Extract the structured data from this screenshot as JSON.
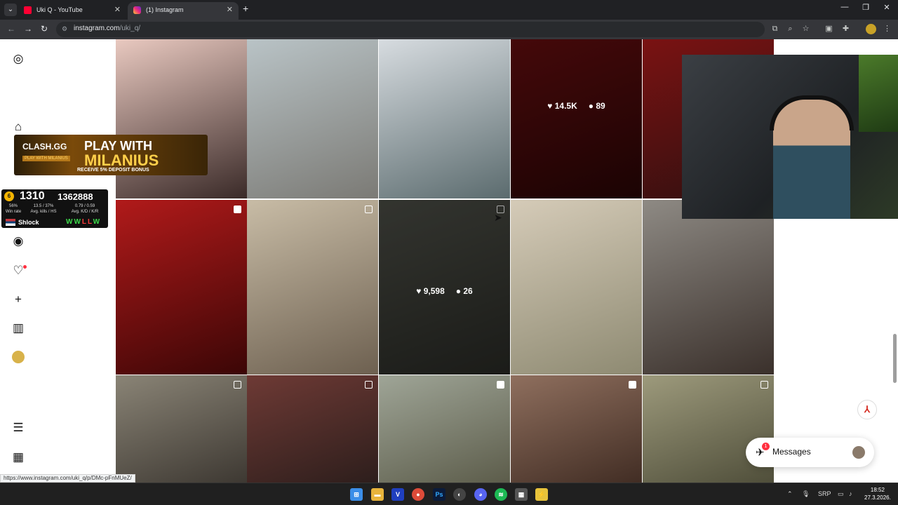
{
  "browser": {
    "tabs": [
      {
        "title": "Uki Q - YouTube"
      },
      {
        "title": "(1) Instagram"
      }
    ],
    "new_tab": "+",
    "url_host": "instagram.com",
    "url_path": "/uki_q/",
    "status_url": "https://www.instagram.com/uki_q/p/DMc-pFnMUeZ/"
  },
  "instagram": {
    "posts": [
      {
        "kind": "image",
        "colors": [
          "#e9c9c0",
          "#3a2a28"
        ]
      },
      {
        "kind": "image",
        "colors": [
          "#b9c3c6",
          "#7b7a75"
        ]
      },
      {
        "kind": "image",
        "colors": [
          "#d7dce0",
          "#5b6b6e"
        ]
      },
      {
        "kind": "image",
        "colors": [
          "#6a0e10",
          "#2a0606"
        ],
        "likes": "14.5K",
        "comments": "89"
      },
      {
        "kind": "image",
        "colors": [
          "#7a1212",
          "#301010"
        ]
      },
      {
        "kind": "reel",
        "colors": [
          "#b11a1a",
          "#3b0606"
        ]
      },
      {
        "kind": "carousel",
        "colors": [
          "#c8bca6",
          "#6d6050"
        ]
      },
      {
        "kind": "carousel",
        "colors": [
          "#4f5149",
          "#2a2b26"
        ],
        "likes": "9,598",
        "comments": "26"
      },
      {
        "kind": "image",
        "colors": [
          "#d5cbb8",
          "#8e8a72"
        ]
      },
      {
        "kind": "image",
        "colors": [
          "#8e8a84",
          "#3a302b"
        ]
      },
      {
        "kind": "carousel",
        "colors": [
          "#8a8476",
          "#3b3630"
        ]
      },
      {
        "kind": "carousel",
        "colors": [
          "#6e3a35",
          "#2b1d1b"
        ]
      },
      {
        "kind": "reel",
        "colors": [
          "#9fa597",
          "#5a5a48"
        ]
      },
      {
        "kind": "reel",
        "colors": [
          "#8f6f5e",
          "#3f2b22"
        ]
      },
      {
        "kind": "carousel",
        "colors": [
          "#9d9a7c",
          "#4d4c38"
        ]
      }
    ],
    "messages_label": "Messages",
    "messages_badge": "1"
  },
  "overlays": {
    "promo": {
      "brand": "CLASH.GG",
      "tag": "PLAY WITH MILANIUS",
      "headline1": "PLAY WITH",
      "headline2": "MILANIUS",
      "subline": "RECEIVE 5% DEPOSIT BONUS"
    },
    "faceit": {
      "level": "6",
      "elo": "1310",
      "points": "1362888",
      "col1_value": "56%",
      "col1_label": "Win rate",
      "col2_value": "13.5 / 37%",
      "col2_label": "Avg. kills / HS",
      "col3_value": "0.79 / 0.59",
      "col3_label": "Avg. K/D / K/R",
      "player": "Shlock",
      "last_results": "WWLLW"
    }
  },
  "taskbar": {
    "language": "SRP",
    "time": "18:52",
    "date": "27.3.2026."
  },
  "colors": {
    "chrome_dark": "#202124",
    "toolbar": "#35363a",
    "notification": "#ff3040"
  }
}
